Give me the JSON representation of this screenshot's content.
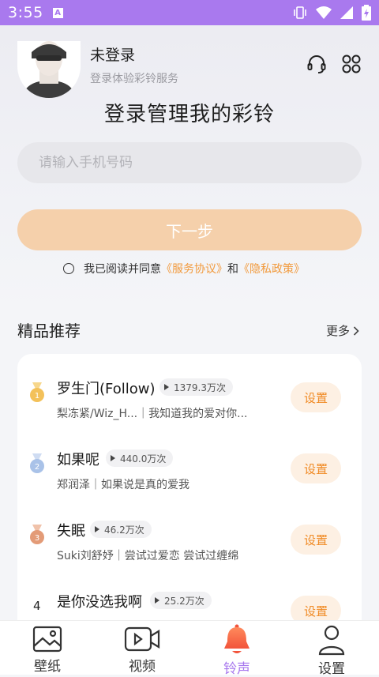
{
  "status_bar": {
    "time": "3:55",
    "badge": "A"
  },
  "header": {
    "user_name": "未登录",
    "user_subtitle": "登录体验彩铃服务"
  },
  "login": {
    "title": "登录管理我的彩铃",
    "phone_placeholder": "请输入手机号码",
    "next_label": "下一步",
    "agree_prefix": "我已阅读并同意",
    "service_link": "《服务协议》",
    "and": "和",
    "privacy_link": "《隐私政策》"
  },
  "recommend": {
    "title": "精品推荐",
    "more_label": "更多",
    "songs": [
      {
        "rank": "1",
        "title": "罗生门(Follow)",
        "plays": "1379.3万次",
        "subtitle": "梨冻紧/Wiz_H...｜我知道我的爱对你...",
        "action": "设置",
        "medal_color": "#f3c15a"
      },
      {
        "rank": "2",
        "title": "如果呢",
        "plays": "440.0万次",
        "subtitle": "郑润泽｜如果说是真的爱我",
        "action": "设置",
        "medal_color": "#a9c2e8"
      },
      {
        "rank": "3",
        "title": "失眠",
        "plays": "46.2万次",
        "subtitle": "Suki刘舒妤｜尝试过爱恋 尝试过缠绵",
        "action": "设置",
        "medal_color": "#e39b77"
      },
      {
        "rank": "4",
        "title": "是你没选我啊",
        "plays": "25.2万次",
        "subtitle": "",
        "action": "设置"
      }
    ]
  },
  "tabs": [
    {
      "label": "壁纸",
      "icon": "wallpaper-icon"
    },
    {
      "label": "视频",
      "icon": "video-icon"
    },
    {
      "label": "铃声",
      "icon": "bell-icon",
      "active": true
    },
    {
      "label": "设置",
      "icon": "user-icon"
    }
  ],
  "colors": {
    "accent": "#a777ee",
    "orange": "#f08a24",
    "button": "#f5d0ab"
  }
}
